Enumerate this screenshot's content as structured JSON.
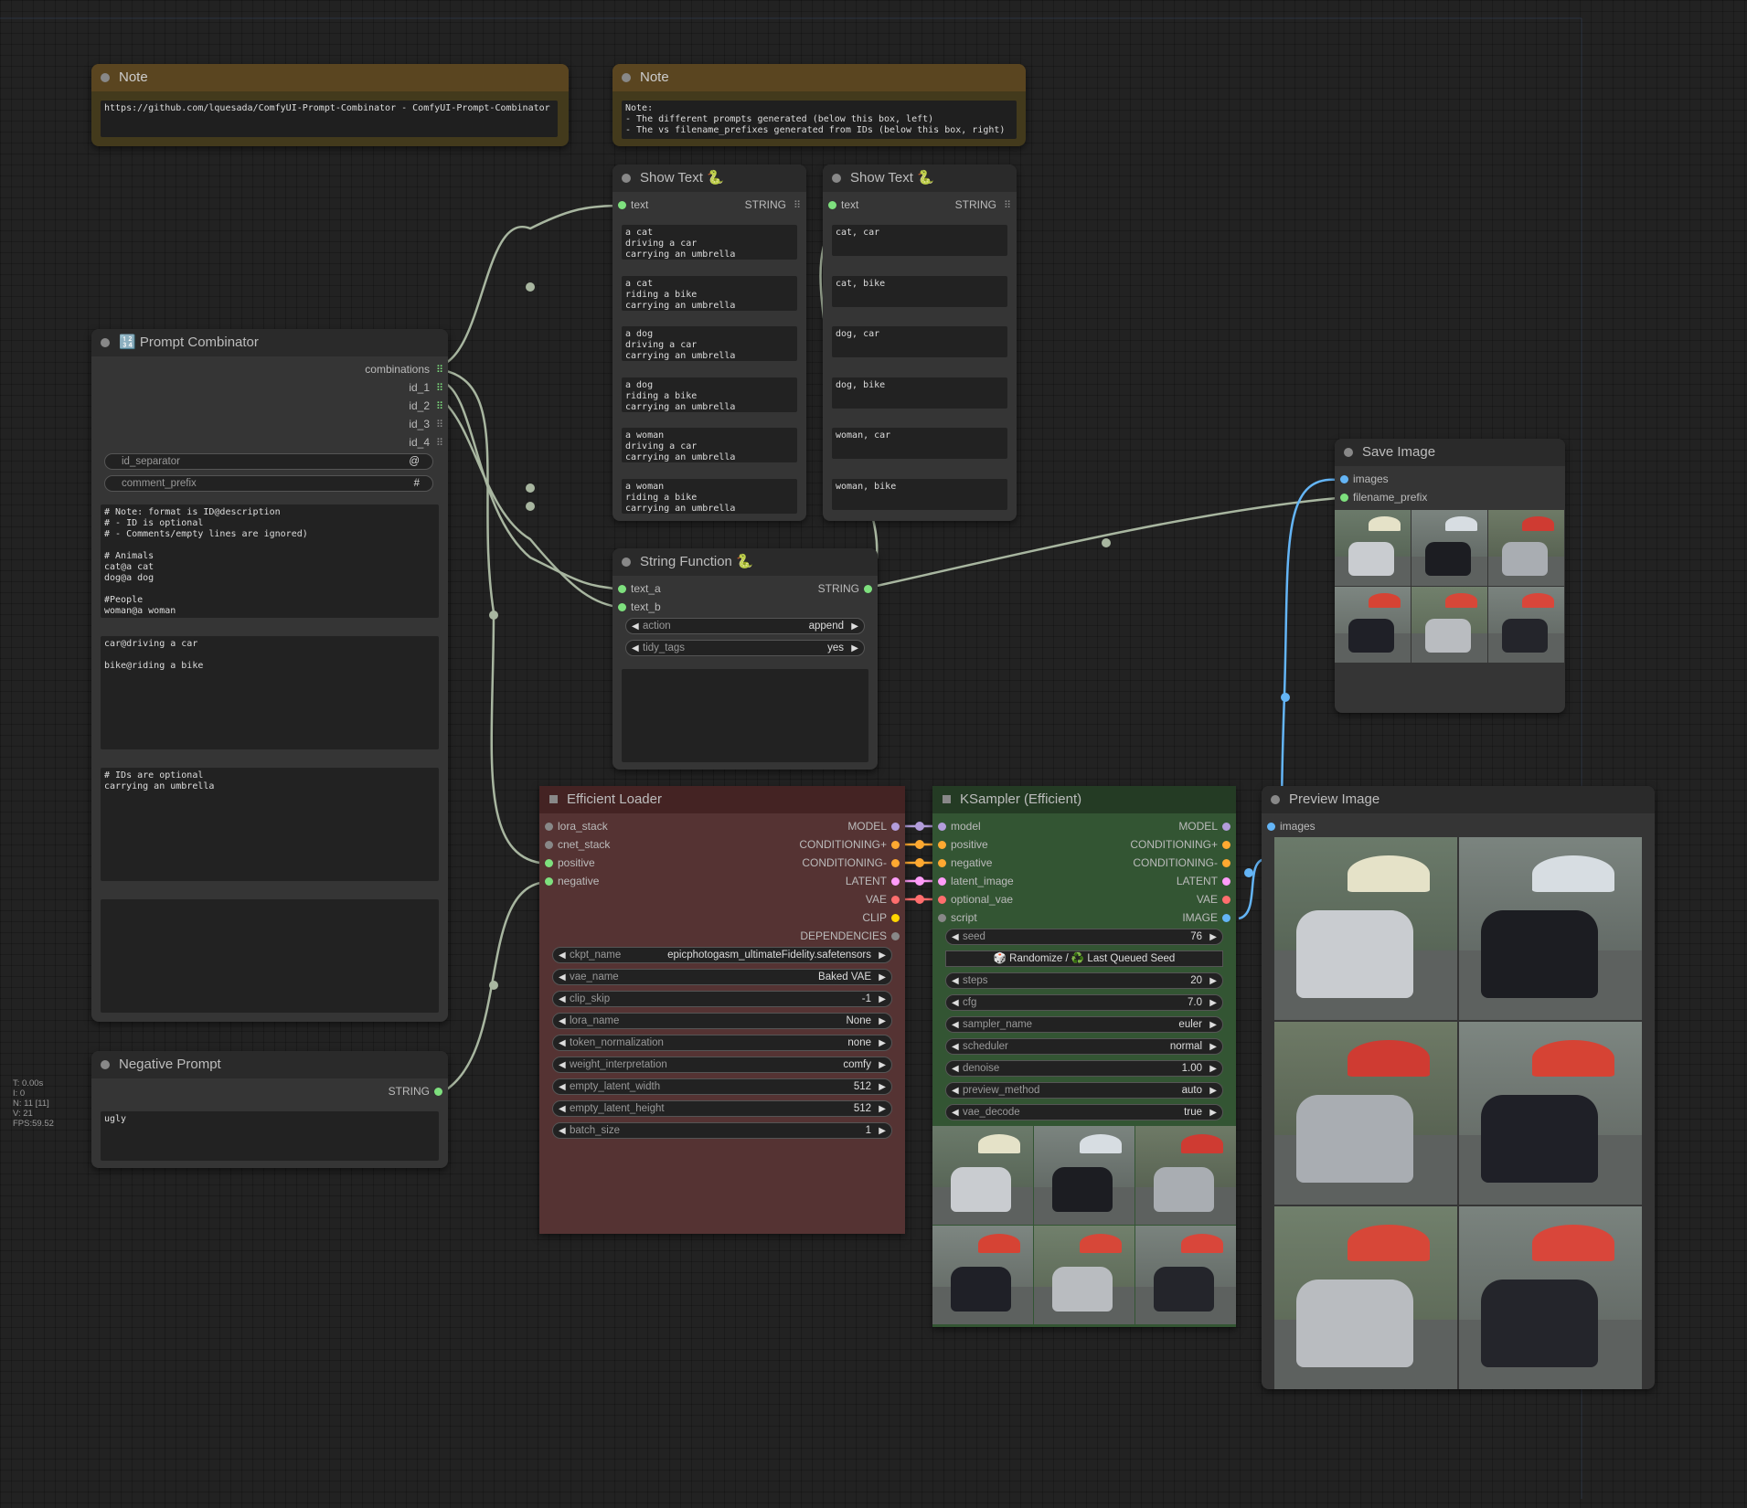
{
  "note1": {
    "title": "Note",
    "text": "https://github.com/lquesada/ComfyUI-Prompt-Combinator - ComfyUI-Prompt-Combinator"
  },
  "note2": {
    "title": "Note",
    "text": "Note:\n- The different prompts generated (below this box, left)\n- The vs filename_prefixes generated from IDs (below this box, right)"
  },
  "show_text_1": {
    "title": "Show Text 🐍",
    "input": "text",
    "output": "STRING",
    "items": [
      "a cat\ndriving a car\ncarrying an umbrella",
      "a cat\nriding a bike\ncarrying an umbrella",
      "a dog\ndriving a car\ncarrying an umbrella",
      "a dog\nriding a bike\ncarrying an umbrella",
      "a woman\ndriving a car\ncarrying an umbrella",
      "a woman\nriding a bike\ncarrying an umbrella"
    ]
  },
  "show_text_2": {
    "title": "Show Text 🐍",
    "input": "text",
    "output": "STRING",
    "items": [
      "cat, car",
      "cat, bike",
      "dog, car",
      "dog, bike",
      "woman, car",
      "woman, bike"
    ]
  },
  "prompt_combinator": {
    "title": "🔢 Prompt Combinator",
    "outputs": [
      "combinations",
      "id_1",
      "id_2",
      "id_3",
      "id_4"
    ],
    "id_separator": {
      "label": "id_separator",
      "value": "@"
    },
    "comment_prefix": {
      "label": "comment_prefix",
      "value": "#"
    },
    "text1": "# Note: format is ID@description\n# - ID is optional\n# - Comments/empty lines are ignored)\n\n# Animals\ncat@a cat\ndog@a dog\n\n#People\nwoman@a woman",
    "text2": "car@driving a car\n\nbike@riding a bike",
    "text3": "# IDs are optional\ncarrying an umbrella",
    "text4": ""
  },
  "string_function": {
    "title": "String Function 🐍",
    "inputs": [
      "text_a",
      "text_b"
    ],
    "output": "STRING",
    "action": {
      "label": "action",
      "value": "append"
    },
    "tidy_tags": {
      "label": "tidy_tags",
      "value": "yes"
    }
  },
  "save_image": {
    "title": "Save Image",
    "inputs": [
      "images",
      "filename_prefix"
    ]
  },
  "negative_prompt": {
    "title": "Negative Prompt",
    "output": "STRING",
    "text": "ugly"
  },
  "efficient_loader": {
    "title": "Efficient Loader",
    "inputs": [
      "lora_stack",
      "cnet_stack",
      "positive",
      "negative"
    ],
    "outputs": [
      "MODEL",
      "CONDITIONING+",
      "CONDITIONING-",
      "LATENT",
      "VAE",
      "CLIP",
      "DEPENDENCIES"
    ],
    "widgets": [
      {
        "label": "ckpt_name",
        "value": "epicphotogasm_ultimateFidelity.safetensors"
      },
      {
        "label": "vae_name",
        "value": "Baked VAE"
      },
      {
        "label": "clip_skip",
        "value": "-1"
      },
      {
        "label": "lora_name",
        "value": "None"
      },
      {
        "label": "token_normalization",
        "value": "none"
      },
      {
        "label": "weight_interpretation",
        "value": "comfy"
      },
      {
        "label": "empty_latent_width",
        "value": "512"
      },
      {
        "label": "empty_latent_height",
        "value": "512"
      },
      {
        "label": "batch_size",
        "value": "1"
      }
    ]
  },
  "ksampler": {
    "title": "KSampler (Efficient)",
    "inputs": [
      "model",
      "positive",
      "negative",
      "latent_image",
      "optional_vae",
      "script"
    ],
    "outputs": [
      "MODEL",
      "CONDITIONING+",
      "CONDITIONING-",
      "LATENT",
      "VAE",
      "IMAGE"
    ],
    "seed": {
      "label": "seed",
      "value": "76"
    },
    "seed_button": "🎲 Randomize / ♻️ Last Queued Seed",
    "widgets": [
      {
        "label": "steps",
        "value": "20"
      },
      {
        "label": "cfg",
        "value": "7.0"
      },
      {
        "label": "sampler_name",
        "value": "euler"
      },
      {
        "label": "scheduler",
        "value": "normal"
      },
      {
        "label": "denoise",
        "value": "1.00"
      },
      {
        "label": "preview_method",
        "value": "auto"
      },
      {
        "label": "vae_decode",
        "value": "true"
      }
    ]
  },
  "preview_image": {
    "title": "Preview Image",
    "input": "images"
  },
  "stats": [
    "T: 0.00s",
    "I: 0",
    "N: 11 [11]",
    "V: 21",
    "FPS:59.52"
  ],
  "colors": {
    "canvas": "#222222",
    "node_body": "#353535",
    "node_title": "#2a2a2a",
    "note_body": "#433a1c",
    "note_title": "#5a4520",
    "loader_body": "#553333",
    "loader_title": "#442323",
    "ksampler_body": "#335533",
    "ksampler_title": "#243b24",
    "link": "#a8b6a0",
    "image_link": "#64b5f6",
    "slot_model": "#b39ddb",
    "slot_conditioning": "#ffa931",
    "slot_latent": "#ff9cf9",
    "slot_vae": "#ff6e6e",
    "slot_clip": "#ffd500",
    "slot_image": "#64b5f6",
    "slot_string": "#7ee07e"
  }
}
